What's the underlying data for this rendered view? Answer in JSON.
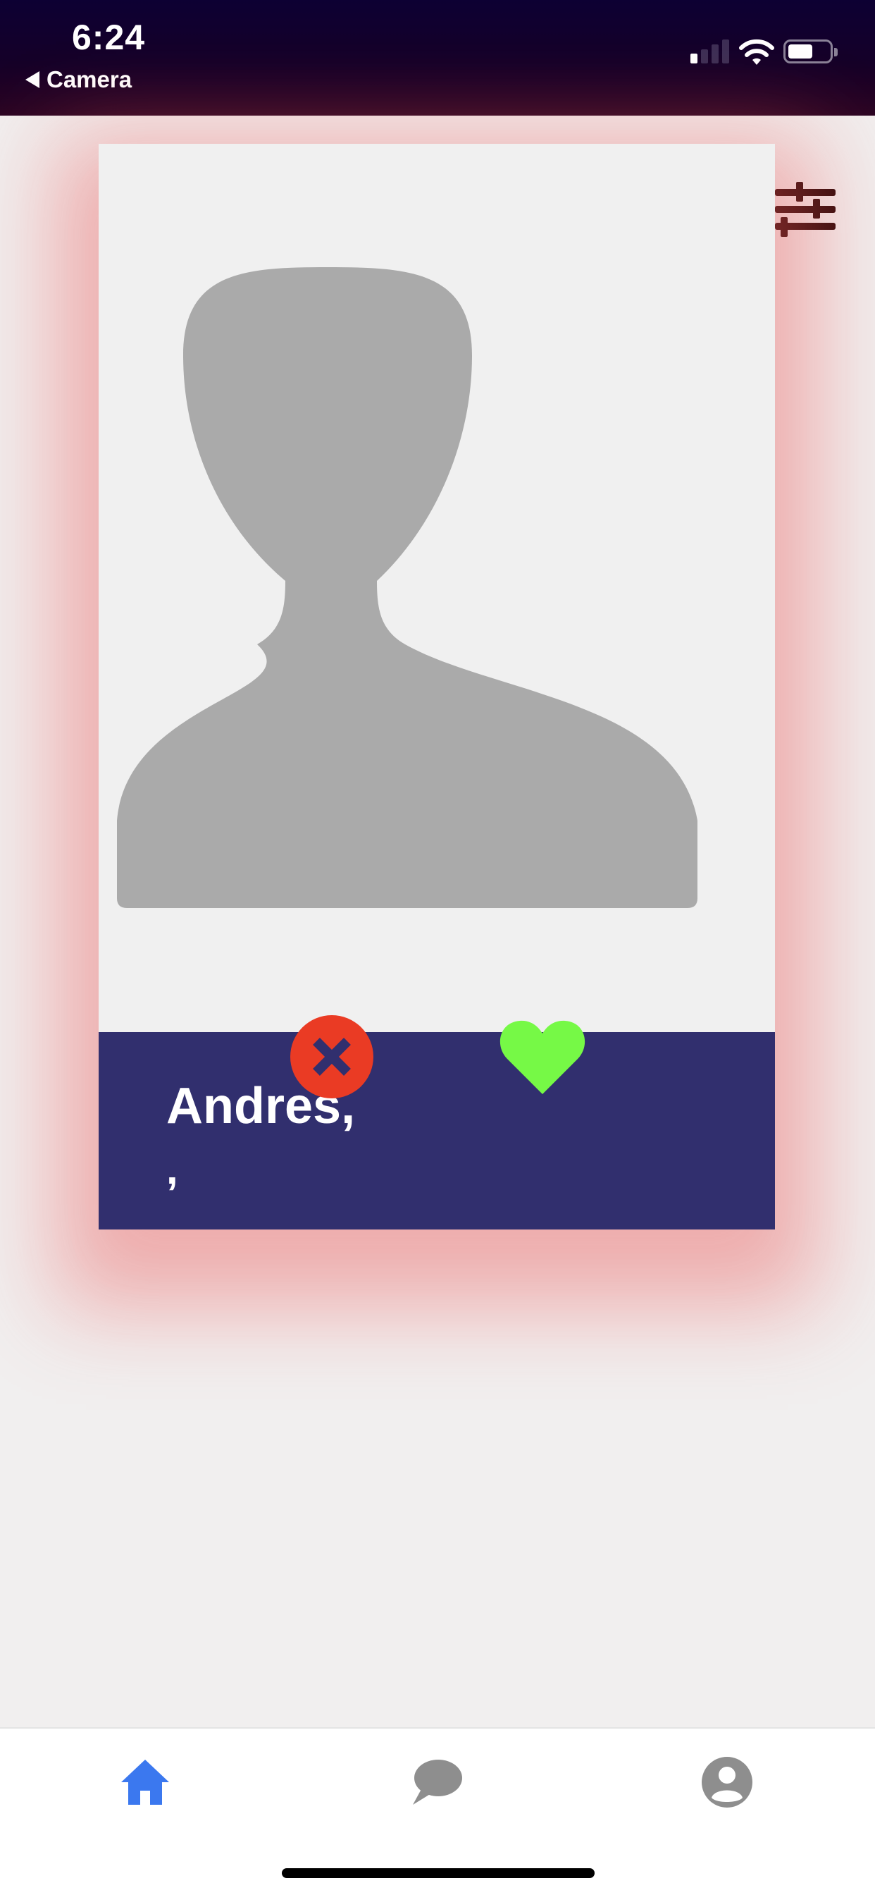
{
  "status_bar": {
    "time": "6:24",
    "back_label": "Camera",
    "signal_bars_active": 1,
    "signal_bars_total": 4,
    "battery_level": 0.6,
    "icons": [
      "signal-icon",
      "wifi-icon",
      "battery-icon"
    ]
  },
  "toolbar": {
    "filter_icon": "sliders-icon"
  },
  "profile_card": {
    "name": "Andres,",
    "subtitle": ",",
    "photo_icon": "person-silhouette-icon",
    "reject_icon": "close-icon",
    "like_icon": "heart-icon",
    "colors": {
      "info_background": "#312f6e",
      "reject": "#ea3b24",
      "like": "#76f946",
      "placeholder": "#aaaaaa"
    }
  },
  "tab_bar": {
    "tabs": [
      {
        "id": "home",
        "icon": "home-icon",
        "active": true
      },
      {
        "id": "messages",
        "icon": "chat-bubble-icon",
        "active": false
      },
      {
        "id": "profile",
        "icon": "user-circle-icon",
        "active": false
      }
    ],
    "colors": {
      "active": "#3b78ef",
      "inactive": "#8e8e8e"
    }
  }
}
